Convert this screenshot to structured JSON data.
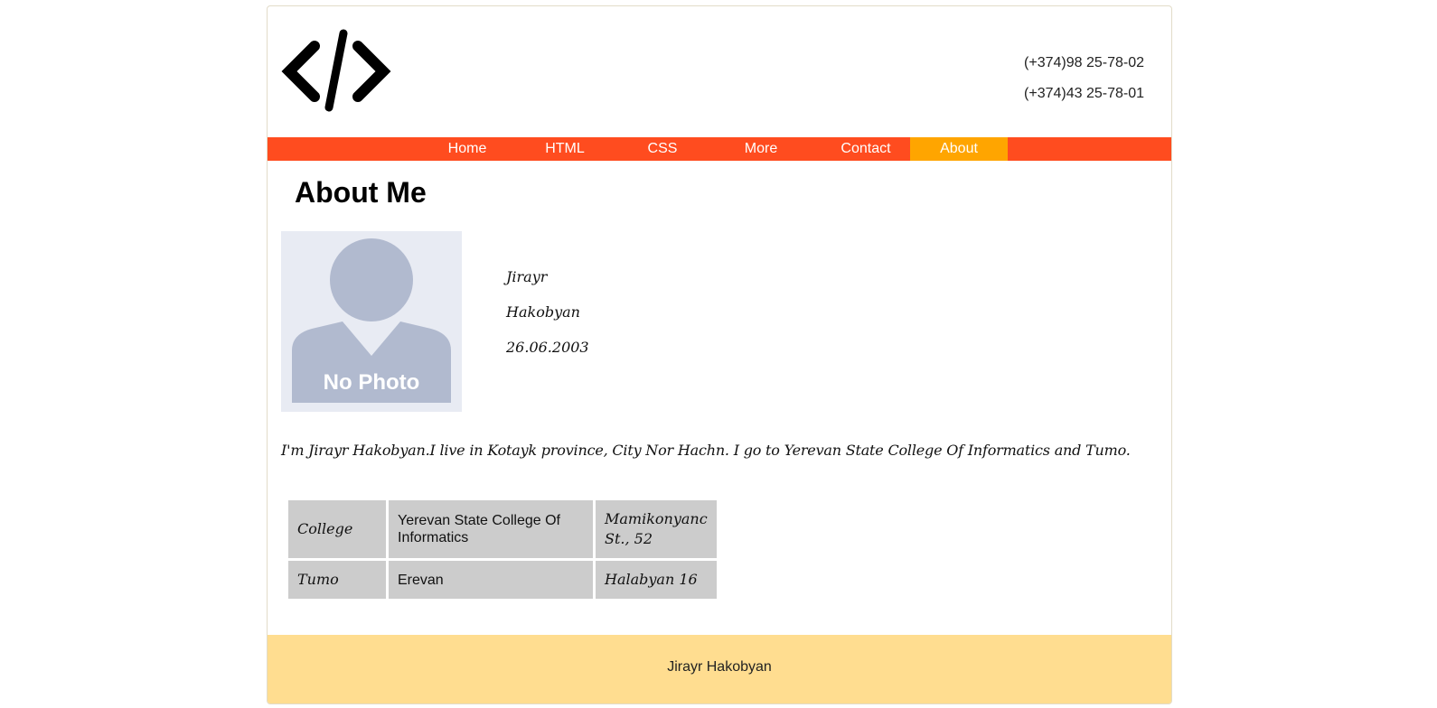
{
  "header": {
    "logo_icon": "code-brackets-icon",
    "phones": [
      "(+374)98 25-78-02",
      "(+374)43 25-78-01"
    ]
  },
  "nav": {
    "items": [
      "Home",
      "HTML",
      "CSS",
      "More",
      "Contact",
      "About"
    ],
    "active": "About",
    "colors": {
      "bar": "#ff4c1f",
      "active": "#ffa500"
    }
  },
  "main": {
    "title": "About Me",
    "photo": {
      "icon": "no-photo-avatar-icon",
      "label": "No Photo"
    },
    "first_name": "Jirayr",
    "last_name": "Hakobyan",
    "birthdate": "26.06.2003",
    "bio": "I'm Jirayr Hakobyan.I live in Kotayk province, City Nor Hachn. I go to Yerevan State College Of Informatics and Tumo.",
    "table": [
      [
        "College",
        "Yerevan State College Of Informatics",
        "Mamikonyanc St., 52"
      ],
      [
        "Tumo",
        "Erevan",
        "Halabyan 16"
      ]
    ]
  },
  "footer": {
    "text": "Jirayr Hakobyan",
    "color": "#ffdd90"
  }
}
